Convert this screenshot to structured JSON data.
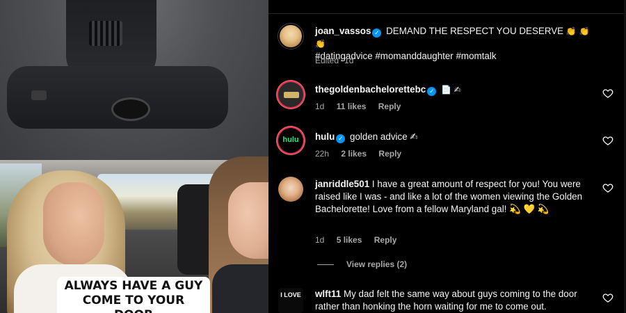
{
  "video": {
    "caption_line1": "ALWAYS HAVE A GUY",
    "caption_line2": "COME TO YOUR DOOR"
  },
  "post": {
    "username": "joan_vassos",
    "caption_text": "DEMAND THE RESPECT YOU DESERVE",
    "caption_emoji": "👏 👏 👏",
    "hashtags": "#datingadvice #momanddaughter #momtalk",
    "edited": "Edited",
    "time": "1d"
  },
  "comments": [
    {
      "username": "thegoldenbachelorettebc",
      "verified": true,
      "text": "📄 ✍",
      "time": "1d",
      "likes": "11 likes",
      "reply": "Reply",
      "avatar_icon": "golden-bachelorette-logo"
    },
    {
      "username": "hulu",
      "verified": true,
      "text": "golden advice ✍",
      "time": "22h",
      "likes": "2 likes",
      "reply": "Reply",
      "avatar_label": "hulu"
    },
    {
      "username": "janriddle501",
      "verified": false,
      "text": "I have a great amount of respect for you! You were raised like I was - and like a lot of the women viewing the Golden Bachelorette! Love from a fellow Maryland gal! 💫 💛 💫",
      "time": "1d",
      "likes": "5 likes",
      "reply": "Reply",
      "view_replies": "View replies (2)"
    },
    {
      "username": "wlft11",
      "verified": false,
      "text": "My dad felt the same way about guys coming to the door rather than honking the horn waiting for me to come out.",
      "avatar_label": "I LOVE"
    }
  ],
  "colors": {
    "verified": "#0095f6",
    "muted": "#a8a8a8",
    "hulu_green": "#1ce783"
  }
}
